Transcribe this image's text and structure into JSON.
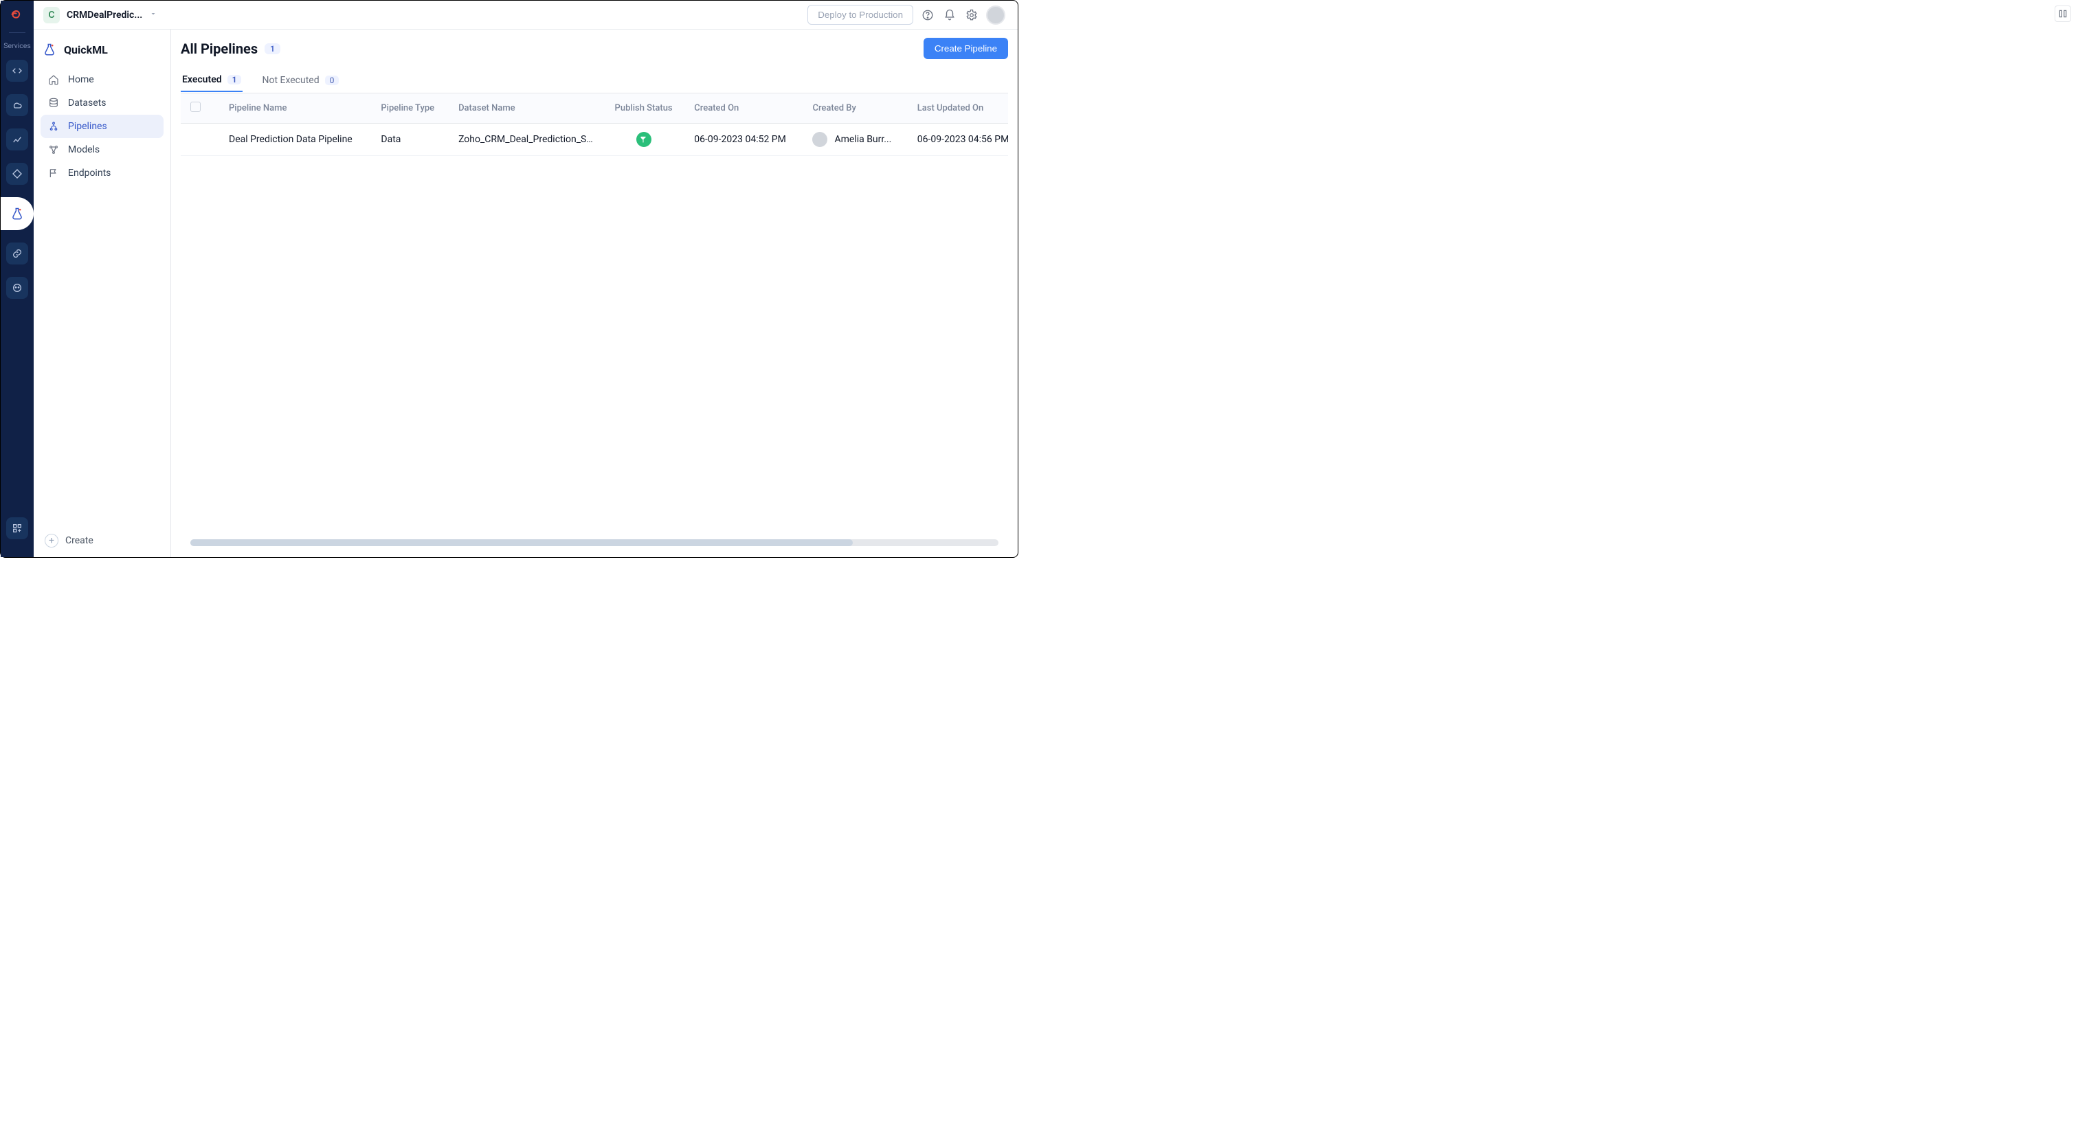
{
  "project": {
    "chip_letter": "C",
    "name": "CRMDealPredic..."
  },
  "topbar": {
    "deploy_label": "Deploy to Production"
  },
  "rail": {
    "services_label": "Services"
  },
  "sidebar": {
    "brand": "QuickML",
    "items": [
      {
        "label": "Home"
      },
      {
        "label": "Datasets"
      },
      {
        "label": "Pipelines"
      },
      {
        "label": "Models"
      },
      {
        "label": "Endpoints"
      }
    ],
    "create_label": "Create"
  },
  "header": {
    "title": "All Pipelines",
    "total": "1",
    "create_label": "Create Pipeline"
  },
  "tabs": [
    {
      "label": "Executed",
      "count": "1"
    },
    {
      "label": "Not Executed",
      "count": "0"
    }
  ],
  "columns": {
    "c1": "Pipeline Name",
    "c2": "Pipeline Type",
    "c3": "Dataset Name",
    "c4": "Publish Status",
    "c5": "Created On",
    "c6": "Created By",
    "c7": "Last Updated On"
  },
  "rows": [
    {
      "name": "Deal Prediction Data Pipeline",
      "type": "Data",
      "dataset": "Zoho_CRM_Deal_Prediction_Sa...",
      "created_on": "06-09-2023 04:52 PM",
      "created_by": "Amelia Burr...",
      "last_updated": "06-09-2023 04:56 PM"
    }
  ]
}
